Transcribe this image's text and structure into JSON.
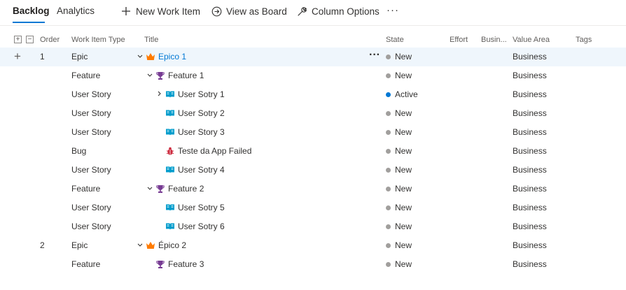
{
  "tabs": {
    "backlog": "Backlog",
    "analytics": "Analytics"
  },
  "toolbar": {
    "new_work_item": "New Work Item",
    "view_as_board": "View as Board",
    "column_options": "Column Options",
    "more": "···"
  },
  "columns": {
    "order": "Order",
    "work_item_type": "Work Item Type",
    "title": "Title",
    "state": "State",
    "effort": "Effort",
    "business_value": "Busin...",
    "value_area": "Value Area",
    "tags": "Tags"
  },
  "colors": {
    "accent": "#0078d4",
    "state_new": "#a19f9d",
    "state_active": "#0078d4",
    "epic": "#ff7b00",
    "feature": "#773b93",
    "user_story": "#009ccc",
    "bug": "#cc293d",
    "selected_row": "#eff6fc"
  },
  "rows": [
    {
      "order": "1",
      "type": "Epic",
      "title": "Epico 1",
      "icon": "crown-icon",
      "chevron": "down",
      "state": "New",
      "value_area": "Business"
    },
    {
      "order": "",
      "type": "Feature",
      "title": "Feature 1",
      "icon": "trophy-icon",
      "chevron": "down",
      "state": "New",
      "value_area": "Business"
    },
    {
      "order": "",
      "type": "User Story",
      "title": "User Sotry 1",
      "icon": "book-icon",
      "chevron": "right",
      "state": "Active",
      "value_area": "Business"
    },
    {
      "order": "",
      "type": "User Story",
      "title": "User Sotry 2",
      "icon": "book-icon",
      "chevron": "",
      "state": "New",
      "value_area": "Business"
    },
    {
      "order": "",
      "type": "User Story",
      "title": "User Story 3",
      "icon": "book-icon",
      "chevron": "",
      "state": "New",
      "value_area": "Business"
    },
    {
      "order": "",
      "type": "Bug",
      "title": "Teste da App Failed",
      "icon": "bug-icon",
      "chevron": "",
      "state": "New",
      "value_area": "Business"
    },
    {
      "order": "",
      "type": "User Story",
      "title": "User Sotry 4",
      "icon": "book-icon",
      "chevron": "",
      "state": "New",
      "value_area": "Business"
    },
    {
      "order": "",
      "type": "Feature",
      "title": "Feature 2",
      "icon": "trophy-icon",
      "chevron": "down",
      "state": "New",
      "value_area": "Business"
    },
    {
      "order": "",
      "type": "User Story",
      "title": "User Sotry 5",
      "icon": "book-icon",
      "chevron": "",
      "state": "New",
      "value_area": "Business"
    },
    {
      "order": "",
      "type": "User Story",
      "title": "User Sotry 6",
      "icon": "book-icon",
      "chevron": "",
      "state": "New",
      "value_area": "Business"
    },
    {
      "order": "2",
      "type": "Epic",
      "title": "Épico 2",
      "icon": "crown-icon",
      "chevron": "down",
      "state": "New",
      "value_area": "Business"
    },
    {
      "order": "",
      "type": "Feature",
      "title": "Feature 3",
      "icon": "trophy-icon",
      "chevron": "",
      "state": "New",
      "value_area": "Business"
    }
  ]
}
